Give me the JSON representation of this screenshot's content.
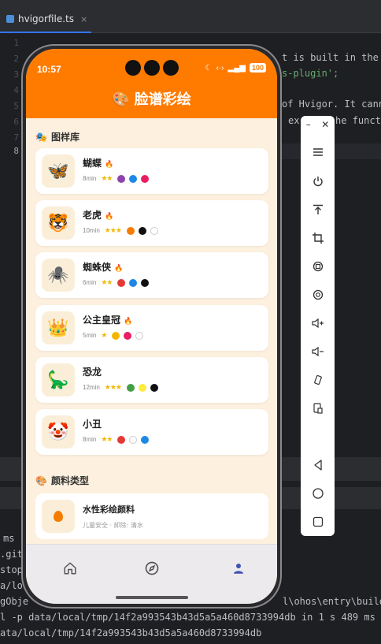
{
  "ide": {
    "tab_label": "hvigorfile.ts",
    "tab_close": "×",
    "line_numbers": [
      "1",
      "2",
      "3",
      "4",
      "5",
      "6",
      "7",
      "8"
    ],
    "code_fragments": {
      "line2": "t is built in the h",
      "line3": "s-plugin';",
      "line5": "of Hvigor. It cann",
      "line6a": "ex",
      "line6b": "he functi"
    },
    "terminal": [
      "ms",
      ".git",
      "stop",
      "a/lo",
      "gObje",
      "l -p data/local/tmp/14f2a993543b43d5a5a460d8733994db in 1 s 489 ms",
      "ata/local/tmp/14f2a993543b43d5a5a460d8733994db"
    ],
    "terminal_right": "l\\ohos\\entry\\build\\"
  },
  "phone": {
    "status": {
      "time": "10:57",
      "signal_text": "⁴⁶",
      "battery": "100"
    },
    "app": {
      "title_emoji": "🎨",
      "title": "脸谱彩绘"
    },
    "patterns_section": {
      "icon": "🎭",
      "title": "图样库"
    },
    "patterns": [
      {
        "emoji": "🦋",
        "name": "蝴蝶",
        "hot": true,
        "time": "8min",
        "stars": "★★",
        "colors": [
          "#8e44ad",
          "#1e88e5",
          "#e91e63"
        ]
      },
      {
        "emoji": "🐯",
        "name": "老虎",
        "hot": true,
        "time": "10min",
        "stars": "★★★",
        "colors": [
          "#f57c00",
          "#111111",
          "#ffffff"
        ]
      },
      {
        "emoji": "🕷️",
        "name": "蜘蛛侠",
        "hot": true,
        "time": "6min",
        "stars": "★★",
        "colors": [
          "#e53935",
          "#1e88e5",
          "#111111"
        ]
      },
      {
        "emoji": "👑",
        "name": "公主皇冠",
        "hot": true,
        "time": "5min",
        "stars": "★",
        "colors": [
          "#f2b705",
          "#e91e63",
          "#ffffff"
        ]
      },
      {
        "emoji": "🦕",
        "name": "恐龙",
        "hot": false,
        "time": "12min",
        "stars": "★★★",
        "colors": [
          "#43a047",
          "#ffeb3b",
          "#111111"
        ]
      },
      {
        "emoji": "🤡",
        "name": "小丑",
        "hot": false,
        "time": "8min",
        "stars": "★★",
        "colors": [
          "#e53935",
          "#ffffff",
          "#1e88e5"
        ]
      }
    ],
    "hot_glyph": "🔥",
    "paint_section": {
      "icon": "🎨",
      "title": "颜料类型"
    },
    "paint_item": {
      "name": "水性彩绘颜料",
      "desc": "儿童安全 · 卸除: 清水"
    },
    "tabs": [
      "home-icon",
      "explore-icon",
      "profile-icon"
    ],
    "accent": "#ff7b00",
    "background": "#fdf0de"
  },
  "emulator_toolbar": {
    "minimize": "–",
    "close": "✕",
    "buttons": [
      "menu-icon",
      "power-icon",
      "upload-icon",
      "crop-icon",
      "rotate-left-icon",
      "rotate-right-icon",
      "volume-up-icon",
      "volume-down-icon",
      "shake-icon",
      "screenshot-icon",
      "back-icon",
      "home-circle-icon",
      "recent-apps-icon"
    ]
  }
}
